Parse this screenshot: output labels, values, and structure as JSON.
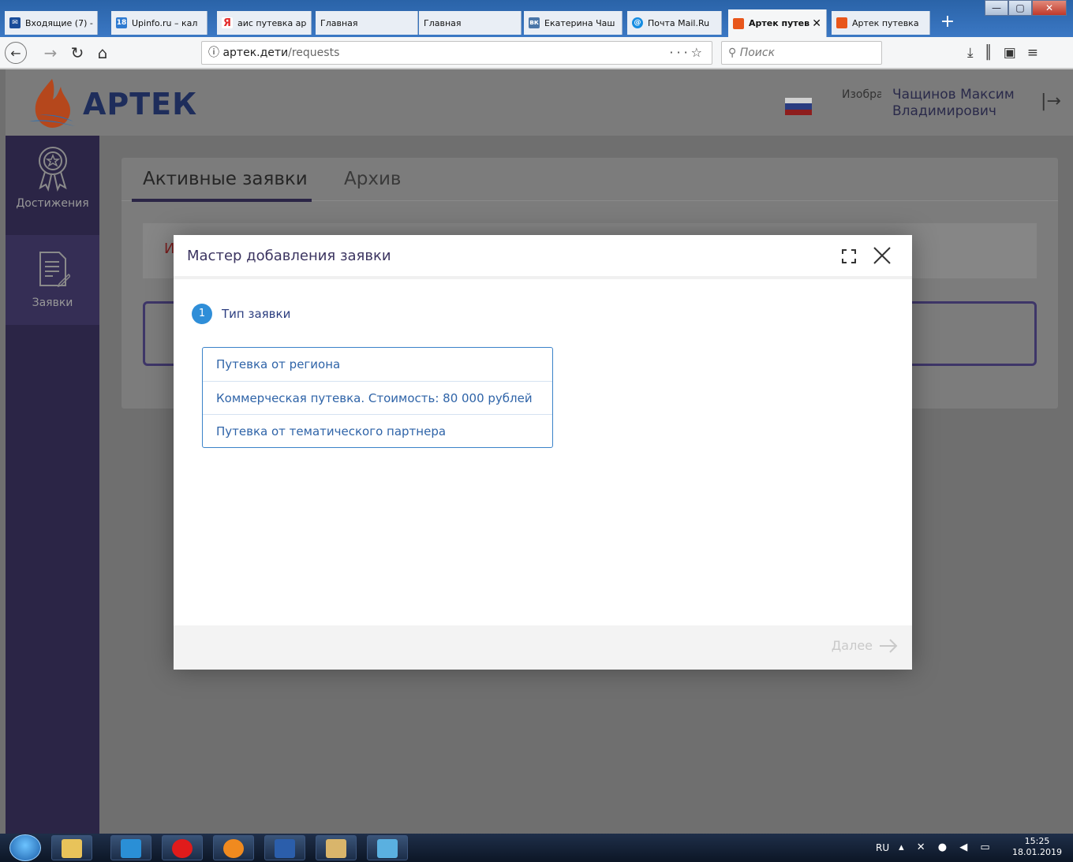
{
  "browser": {
    "tabs": [
      {
        "label": "Входящие (7) -",
        "icon": "mail-icon",
        "color": "#1a4d9a"
      },
      {
        "label": "Upinfo.ru – кал",
        "icon": "calendar-icon",
        "color": "#2f7bd1"
      },
      {
        "label": "аис путевка ар",
        "icon": "yandex-icon",
        "color": "#e32b2b"
      },
      {
        "label": "Главная",
        "icon": "",
        "color": ""
      },
      {
        "label": "Главная",
        "icon": "",
        "color": ""
      },
      {
        "label": "Екатерина Чаш",
        "icon": "vk-icon",
        "color": "#4a76a8"
      },
      {
        "label": "Почта Mail.Ru",
        "icon": "mailru-icon",
        "color": "#168de2"
      },
      {
        "label": "Артек путев",
        "icon": "artek-icon",
        "color": "#e8561b",
        "active": true
      },
      {
        "label": "Артек путевка",
        "icon": "artek-icon",
        "color": "#e8561b"
      }
    ],
    "url_host": "артек.дети",
    "url_path": "/requests",
    "search_placeholder": "Поиск"
  },
  "header": {
    "logo_text": "АРТЕК",
    "avatar_alt": "Изображение пользователя",
    "user_name": "Чащинов Максим Владимирович"
  },
  "sidebar": {
    "items": [
      {
        "label": "Достижения",
        "icon": "medal-icon"
      },
      {
        "label": "Заявки",
        "icon": "document-edit-icon"
      }
    ]
  },
  "content": {
    "tabs": [
      {
        "label": "Активные заявки",
        "active": true
      },
      {
        "label": "Архив",
        "active": false
      }
    ],
    "info_letter": "И"
  },
  "modal": {
    "title": "Мастер добавления заявки",
    "step": {
      "number": "1",
      "label": "Тип заявки"
    },
    "options": [
      "Путевка от региона",
      "Коммерческая путевка. Стоимость: 80 000 рублей",
      "Путевка от тематического партнера"
    ],
    "next_label": "Далее"
  },
  "taskbar": {
    "lang": "RU",
    "time": "15:25",
    "date": "18.01.2019"
  },
  "colors": {
    "sidebar_bg": "#2b2546",
    "accent_blue": "#2f8ed8",
    "modal_title": "#3b3460"
  }
}
